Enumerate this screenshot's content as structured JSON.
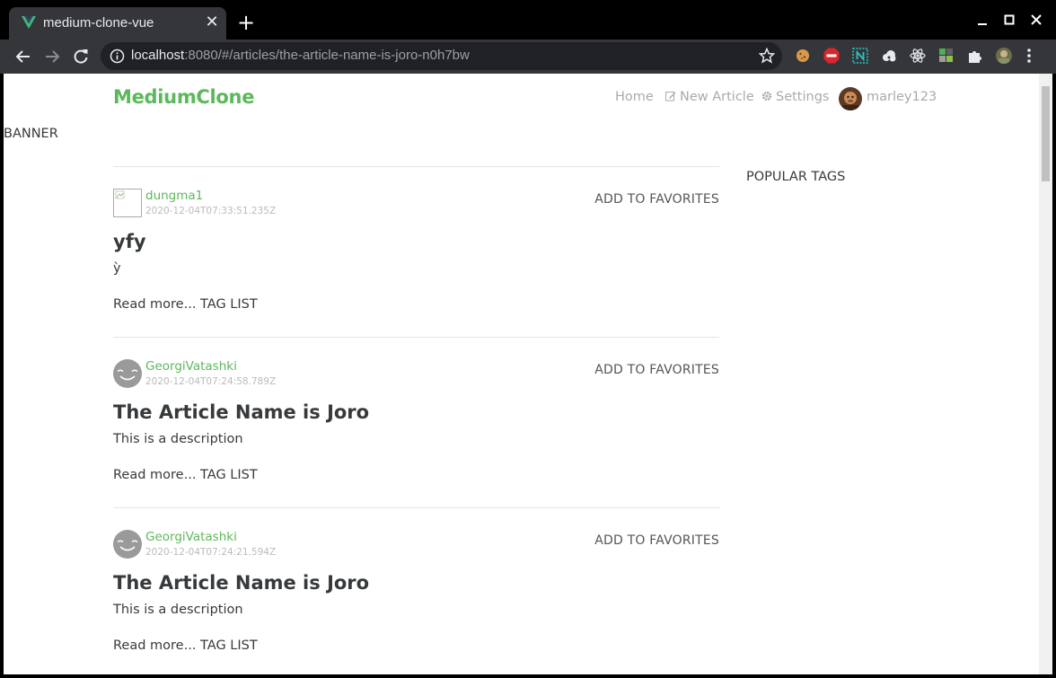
{
  "browser": {
    "tab_title": "medium-clone-vue",
    "url_host": "localhost",
    "url_rest": ":8080/#/articles/the-article-name-is-joro-n0h7bw",
    "tab_close": "✕",
    "new_tab": "+",
    "extensions": [
      "cookie-icon",
      "adblock-icon",
      "n-icon",
      "cloud-icon",
      "react-icon",
      "tag-icon",
      "puzzle-icon",
      "profile-icon"
    ]
  },
  "header": {
    "brand": "MediumClone",
    "nav": {
      "home": "Home",
      "new_article": "New Article",
      "settings": "Settings",
      "user": "marley123"
    }
  },
  "banner": "BANNER",
  "sidebar": {
    "title": "POPULAR TAGS"
  },
  "articles": [
    {
      "author": "dungma1",
      "date": "2020-12-04T07:33:51.235Z",
      "favorite_label": "ADD TO FAVORITES",
      "title": "yfy",
      "description": "ỳ",
      "read_more": "Read more...",
      "tag_list": "TAG LIST"
    },
    {
      "author": "GeorgiVatashki",
      "date": "2020-12-04T07:24:58.789Z",
      "favorite_label": "ADD TO FAVORITES",
      "title": "The Article Name is Joro",
      "description": "This is a description",
      "read_more": "Read more...",
      "tag_list": "TAG LIST"
    },
    {
      "author": "GeorgiVatashki",
      "date": "2020-12-04T07:24:21.594Z",
      "favorite_label": "ADD TO FAVORITES",
      "title": "The Article Name is Joro",
      "description": "This is a description",
      "read_more": "Read more...",
      "tag_list": "TAG LIST"
    }
  ],
  "colors": {
    "accent": "#5cb85c",
    "nav_text": "#aaaaaa",
    "body_text": "#373a3c"
  }
}
